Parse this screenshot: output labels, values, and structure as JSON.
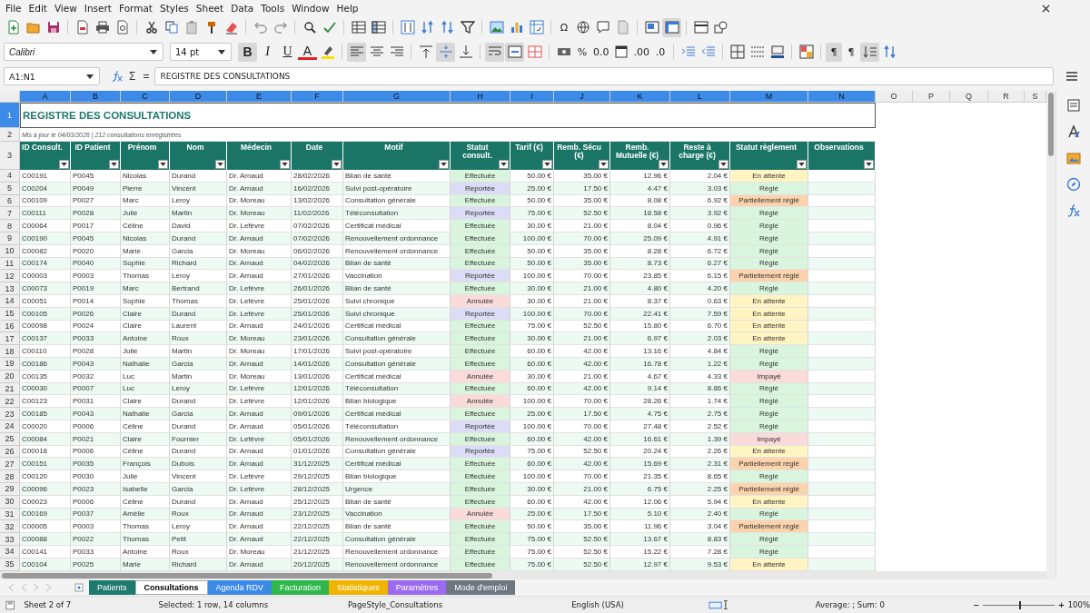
{
  "menu": [
    "File",
    "Edit",
    "View",
    "Insert",
    "Format",
    "Styles",
    "Sheet",
    "Data",
    "Tools",
    "Window",
    "Help"
  ],
  "toolbar_1": [
    {
      "kind": "new",
      "pressed": false
    },
    {
      "kind": "open",
      "pressed": false
    },
    {
      "kind": "save",
      "pressed": false
    },
    {
      "kind": "pdf",
      "pressed": false
    },
    {
      "kind": "print",
      "pressed": false
    },
    {
      "kind": "preview",
      "pressed": false
    },
    {
      "kind": "cut",
      "pressed": false
    },
    {
      "kind": "copy",
      "pressed": false
    },
    {
      "kind": "paste",
      "pressed": false
    },
    {
      "kind": "clone",
      "pressed": false
    },
    {
      "kind": "clear",
      "pressed": false
    },
    {
      "kind": "undo",
      "pressed": false
    },
    {
      "kind": "redo",
      "pressed": false
    },
    {
      "kind": "find",
      "pressed": false
    },
    {
      "kind": "spell",
      "pressed": false
    },
    {
      "kind": "rows",
      "pressed": false
    },
    {
      "kind": "cols",
      "pressed": false
    },
    {
      "kind": "sort",
      "pressed": false
    },
    {
      "kind": "sortasc",
      "pressed": false
    },
    {
      "kind": "sortdesc",
      "pressed": false
    },
    {
      "kind": "filter",
      "pressed": false
    },
    {
      "kind": "image",
      "pressed": false
    },
    {
      "kind": "chart",
      "pressed": false
    },
    {
      "kind": "pivot",
      "pressed": false
    },
    {
      "kind": "char",
      "label": "Ω",
      "pressed": false
    },
    {
      "kind": "link",
      "pressed": false
    },
    {
      "kind": "comment",
      "pressed": false
    },
    {
      "kind": "headerfooter",
      "pressed": false
    },
    {
      "kind": "printarea",
      "pressed": false
    },
    {
      "kind": "freeze",
      "pressed": true
    },
    {
      "kind": "split",
      "pressed": false
    },
    {
      "kind": "shapes",
      "pressed": false
    }
  ],
  "font_name": "Calibri",
  "font_size": "14 pt",
  "toolbar_2": [
    {
      "kind": "bold",
      "label": "B",
      "pressed": true
    },
    {
      "kind": "italic",
      "label": "I",
      "pressed": false
    },
    {
      "kind": "underline",
      "label": "U",
      "pressed": false
    },
    {
      "kind": "fontcolor",
      "label": "A",
      "pressed": false
    },
    {
      "kind": "highlight",
      "pressed": false
    },
    {
      "kind": "alignleft",
      "pressed": true
    },
    {
      "kind": "aligncenter",
      "pressed": false
    },
    {
      "kind": "alignright",
      "pressed": false
    },
    {
      "kind": "aligntop",
      "pressed": false
    },
    {
      "kind": "alignmiddle",
      "pressed": true
    },
    {
      "kind": "alignbottom",
      "pressed": false
    },
    {
      "kind": "wrap",
      "pressed": true
    },
    {
      "kind": "merge",
      "pressed": true
    },
    {
      "kind": "unmerge",
      "pressed": false
    },
    {
      "kind": "currency",
      "pressed": false
    },
    {
      "kind": "char",
      "label": "%",
      "pressed": false
    },
    {
      "kind": "char",
      "label": "0.0",
      "pressed": false
    },
    {
      "kind": "date",
      "pressed": false
    },
    {
      "kind": "char",
      "label": ".00",
      "pressed": false
    },
    {
      "kind": "char",
      "label": ".0",
      "pressed": false
    },
    {
      "kind": "indent",
      "pressed": false
    },
    {
      "kind": "outdent",
      "pressed": false
    },
    {
      "kind": "borders",
      "pressed": false
    },
    {
      "kind": "borderstyle",
      "pressed": false
    },
    {
      "kind": "bordercolor",
      "pressed": false
    },
    {
      "kind": "conditional",
      "pressed": false
    },
    {
      "kind": "char",
      "label": "¶",
      "pressed": true
    },
    {
      "kind": "char",
      "label": "¶",
      "pressed": false
    },
    {
      "kind": "textdir",
      "pressed": true
    },
    {
      "kind": "sortdesc",
      "pressed": false
    }
  ],
  "formula_bar": {
    "name_box": "A1:N1",
    "sum": "Σ",
    "equals": "=",
    "content": "REGISTRE DES CONSULTATIONS"
  },
  "columns": [
    {
      "letter": "A",
      "selected": true
    },
    {
      "letter": "B",
      "selected": true
    },
    {
      "letter": "C",
      "selected": true
    },
    {
      "letter": "D",
      "selected": true
    },
    {
      "letter": "E",
      "selected": true
    },
    {
      "letter": "F",
      "selected": true
    },
    {
      "letter": "G",
      "selected": true
    },
    {
      "letter": "H",
      "selected": true
    },
    {
      "letter": "I",
      "selected": true
    },
    {
      "letter": "J",
      "selected": true
    },
    {
      "letter": "K",
      "selected": true
    },
    {
      "letter": "L",
      "selected": true
    },
    {
      "letter": "M",
      "selected": true
    },
    {
      "letter": "N",
      "selected": true
    },
    {
      "letter": "O",
      "selected": false
    },
    {
      "letter": "P",
      "selected": false
    },
    {
      "letter": "Q",
      "selected": false
    },
    {
      "letter": "R",
      "selected": false
    },
    {
      "letter": "S",
      "selected": false
    }
  ],
  "title_row": {
    "n": "1",
    "text": "REGISTRE DES CONSULTATIONS",
    "selected": true
  },
  "subtitle_row": {
    "n": "2",
    "text": "Mis à jour le 04/03/2026 | 212 consultations enregistrées"
  },
  "header_row": {
    "n": "3",
    "headers": [
      "ID Consult.",
      "ID Patient",
      "Prénom",
      "Nom",
      "Médecin",
      "Date",
      "Motif",
      "Statut consult.",
      "Tarif (€)",
      "Remb. Sécu (€)",
      "Remb. Mutuelle (€)",
      "Reste à charge (€)",
      "Statut règlement",
      "Observations"
    ]
  },
  "rows": [
    {
      "n": "4",
      "cells": [
        "C00191",
        "P0045",
        "Nicolas",
        "Durand",
        "Dr. Arnaud",
        "28/02/2026",
        "Bilan de santé"
      ],
      "statut": {
        "text": "Effectuée",
        "color": "#d9f5dd"
      },
      "amounts": [
        "50.00 €",
        "35.00 €",
        "12.96 €",
        "2.04 €"
      ],
      "reglement": {
        "text": "En attente",
        "color": "#fff4c2"
      }
    },
    {
      "n": "5",
      "cells": [
        "C00204",
        "P0049",
        "Pierre",
        "Vincent",
        "Dr. Arnaud",
        "16/02/2026",
        "Suivi post-opératoire"
      ],
      "statut": {
        "text": "Reportée",
        "color": "#dcdcf7"
      },
      "amounts": [
        "25.00 €",
        "17.50 €",
        "4.47 €",
        "3.03 €"
      ],
      "reglement": {
        "text": "Réglé",
        "color": "#d9f5dd"
      }
    },
    {
      "n": "6",
      "cells": [
        "C00109",
        "P0027",
        "Marc",
        "Leroy",
        "Dr. Moreau",
        "13/02/2026",
        "Consultation générale"
      ],
      "statut": {
        "text": "Effectuée",
        "color": "#d9f5dd"
      },
      "amounts": [
        "50.00 €",
        "35.00 €",
        "8.08 €",
        "6.92 €"
      ],
      "reglement": {
        "text": "Partiellement réglé",
        "color": "#fcd3ac"
      }
    },
    {
      "n": "7",
      "cells": [
        "C00111",
        "P0028",
        "Julie",
        "Martin",
        "Dr. Moreau",
        "11/02/2026",
        "Téléconsultation"
      ],
      "statut": {
        "text": "Reportée",
        "color": "#dcdcf7"
      },
      "amounts": [
        "75.00 €",
        "52.50 €",
        "18.58 €",
        "3.92 €"
      ],
      "reglement": {
        "text": "Réglé",
        "color": "#d9f5dd"
      }
    },
    {
      "n": "8",
      "cells": [
        "C00064",
        "P0017",
        "Céline",
        "David",
        "Dr. Lefèvre",
        "07/02/2026",
        "Certificat médical"
      ],
      "statut": {
        "text": "Effectuée",
        "color": "#d9f5dd"
      },
      "amounts": [
        "30.00 €",
        "21.00 €",
        "8.04 €",
        "0.96 €"
      ],
      "reglement": {
        "text": "Réglé",
        "color": "#d9f5dd"
      }
    },
    {
      "n": "9",
      "cells": [
        "C00190",
        "P0045",
        "Nicolas",
        "Durand",
        "Dr. Arnaud",
        "07/02/2026",
        "Renouvellement ordonnance"
      ],
      "statut": {
        "text": "Effectuée",
        "color": "#d9f5dd"
      },
      "amounts": [
        "100.00 €",
        "70.00 €",
        "25.09 €",
        "4.91 €"
      ],
      "reglement": {
        "text": "Réglé",
        "color": "#d9f5dd"
      }
    },
    {
      "n": "10",
      "cells": [
        "C00082",
        "P0020",
        "Marie",
        "Garcia",
        "Dr. Moreau",
        "06/02/2026",
        "Renouvellement ordonnance"
      ],
      "statut": {
        "text": "Effectuée",
        "color": "#d9f5dd"
      },
      "amounts": [
        "50.00 €",
        "35.00 €",
        "8.28 €",
        "6.72 €"
      ],
      "reglement": {
        "text": "Réglé",
        "color": "#d9f5dd"
      }
    },
    {
      "n": "11",
      "cells": [
        "C00174",
        "P0040",
        "Sophie",
        "Richard",
        "Dr. Arnaud",
        "04/02/2026",
        "Bilan de santé"
      ],
      "statut": {
        "text": "Effectuée",
        "color": "#d9f5dd"
      },
      "amounts": [
        "50.00 €",
        "35.00 €",
        "8.73 €",
        "6.27 €"
      ],
      "reglement": {
        "text": "Réglé",
        "color": "#d9f5dd"
      }
    },
    {
      "n": "12",
      "cells": [
        "C00003",
        "P0003",
        "Thomas",
        "Leroy",
        "Dr. Arnaud",
        "27/01/2026",
        "Vaccination"
      ],
      "statut": {
        "text": "Reportée",
        "color": "#dcdcf7"
      },
      "amounts": [
        "100.00 €",
        "70.00 €",
        "23.85 €",
        "6.15 €"
      ],
      "reglement": {
        "text": "Partiellement réglé",
        "color": "#fcd3ac"
      }
    },
    {
      "n": "13",
      "cells": [
        "C00073",
        "P0019",
        "Marc",
        "Bertrand",
        "Dr. Lefèvre",
        "26/01/2026",
        "Bilan de santé"
      ],
      "statut": {
        "text": "Effectuée",
        "color": "#d9f5dd"
      },
      "amounts": [
        "30.00 €",
        "21.00 €",
        "4.80 €",
        "4.20 €"
      ],
      "reglement": {
        "text": "Réglé",
        "color": "#d9f5dd"
      }
    },
    {
      "n": "14",
      "cells": [
        "C00051",
        "P0014",
        "Sophie",
        "Thomas",
        "Dr. Lefèvre",
        "25/01/2026",
        "Suivi chronique"
      ],
      "statut": {
        "text": "Annulée",
        "color": "#fbdada"
      },
      "amounts": [
        "30.00 €",
        "21.00 €",
        "8.37 €",
        "0.63 €"
      ],
      "reglement": {
        "text": "En attente",
        "color": "#fff4c2"
      }
    },
    {
      "n": "15",
      "cells": [
        "C00105",
        "P0026",
        "Claire",
        "Durand",
        "Dr. Lefèvre",
        "25/01/2026",
        "Suivi chronique"
      ],
      "statut": {
        "text": "Reportée",
        "color": "#dcdcf7"
      },
      "amounts": [
        "100.00 €",
        "70.00 €",
        "22.41 €",
        "7.59 €"
      ],
      "reglement": {
        "text": "En attente",
        "color": "#fff4c2"
      }
    },
    {
      "n": "16",
      "cells": [
        "C00098",
        "P0024",
        "Claire",
        "Laurent",
        "Dr. Arnaud",
        "24/01/2026",
        "Certificat médical"
      ],
      "statut": {
        "text": "Effectuée",
        "color": "#d9f5dd"
      },
      "amounts": [
        "75.00 €",
        "52.50 €",
        "15.80 €",
        "6.70 €"
      ],
      "reglement": {
        "text": "En attente",
        "color": "#fff4c2"
      }
    },
    {
      "n": "17",
      "cells": [
        "C00137",
        "P0033",
        "Antoine",
        "Roux",
        "Dr. Moreau",
        "23/01/2026",
        "Consultation générale"
      ],
      "statut": {
        "text": "Effectuée",
        "color": "#d9f5dd"
      },
      "amounts": [
        "30.00 €",
        "21.00 €",
        "6.97 €",
        "2.03 €"
      ],
      "reglement": {
        "text": "En attente",
        "color": "#fff4c2"
      }
    },
    {
      "n": "18",
      "cells": [
        "C00110",
        "P0028",
        "Julie",
        "Martin",
        "Dr. Moreau",
        "17/01/2026",
        "Suivi post-opératoire"
      ],
      "statut": {
        "text": "Effectuée",
        "color": "#d9f5dd"
      },
      "amounts": [
        "60.00 €",
        "42.00 €",
        "13.16 €",
        "4.84 €"
      ],
      "reglement": {
        "text": "Réglé",
        "color": "#d9f5dd"
      }
    },
    {
      "n": "19",
      "cells": [
        "C00186",
        "P0043",
        "Nathalie",
        "Garcia",
        "Dr. Arnaud",
        "14/01/2026",
        "Consultation générale"
      ],
      "statut": {
        "text": "Effectuée",
        "color": "#d9f5dd"
      },
      "amounts": [
        "60.00 €",
        "42.00 €",
        "16.78 €",
        "1.22 €"
      ],
      "reglement": {
        "text": "Réglé",
        "color": "#d9f5dd"
      }
    },
    {
      "n": "20",
      "cells": [
        "C00135",
        "P0032",
        "Luc",
        "Martin",
        "Dr. Moreau",
        "13/01/2026",
        "Certificat médical"
      ],
      "statut": {
        "text": "Annulée",
        "color": "#fbdada"
      },
      "amounts": [
        "30.00 €",
        "21.00 €",
        "4.67 €",
        "4.33 €"
      ],
      "reglement": {
        "text": "Impayé",
        "color": "#fbdada"
      }
    },
    {
      "n": "21",
      "cells": [
        "C00030",
        "P0007",
        "Luc",
        "Leroy",
        "Dr. Lefèvre",
        "12/01/2026",
        "Téléconsultation"
      ],
      "statut": {
        "text": "Effectuée",
        "color": "#d9f5dd"
      },
      "amounts": [
        "60.00 €",
        "42.00 €",
        "9.14 €",
        "8.86 €"
      ],
      "reglement": {
        "text": "Réglé",
        "color": "#d9f5dd"
      }
    },
    {
      "n": "22",
      "cells": [
        "C00123",
        "P0031",
        "Claire",
        "Durand",
        "Dr. Lefèvre",
        "12/01/2026",
        "Bilan biologique"
      ],
      "statut": {
        "text": "Annulée",
        "color": "#fbdada"
      },
      "amounts": [
        "100.00 €",
        "70.00 €",
        "28.26 €",
        "1.74 €"
      ],
      "reglement": {
        "text": "Réglé",
        "color": "#d9f5dd"
      }
    },
    {
      "n": "23",
      "cells": [
        "C00185",
        "P0043",
        "Nathalie",
        "Garcia",
        "Dr. Arnaud",
        "09/01/2026",
        "Certificat médical"
      ],
      "statut": {
        "text": "Effectuée",
        "color": "#d9f5dd"
      },
      "amounts": [
        "25.00 €",
        "17.50 €",
        "4.75 €",
        "2.75 €"
      ],
      "reglement": {
        "text": "Réglé",
        "color": "#d9f5dd"
      }
    },
    {
      "n": "24",
      "cells": [
        "C00020",
        "P0006",
        "Céline",
        "Durand",
        "Dr. Arnaud",
        "05/01/2026",
        "Téléconsultation"
      ],
      "statut": {
        "text": "Reportée",
        "color": "#dcdcf7"
      },
      "amounts": [
        "100.00 €",
        "70.00 €",
        "27.48 €",
        "2.52 €"
      ],
      "reglement": {
        "text": "Réglé",
        "color": "#d9f5dd"
      }
    },
    {
      "n": "25",
      "cells": [
        "C00084",
        "P0021",
        "Claire",
        "Fournier",
        "Dr. Lefèvre",
        "05/01/2026",
        "Renouvellement ordonnance"
      ],
      "statut": {
        "text": "Effectuée",
        "color": "#d9f5dd"
      },
      "amounts": [
        "60.00 €",
        "42.00 €",
        "16.61 €",
        "1.39 €"
      ],
      "reglement": {
        "text": "Impayé",
        "color": "#fbdada"
      }
    },
    {
      "n": "26",
      "cells": [
        "C00018",
        "P0006",
        "Céline",
        "Durand",
        "Dr. Arnaud",
        "01/01/2026",
        "Consultation générale"
      ],
      "statut": {
        "text": "Reportée",
        "color": "#dcdcf7"
      },
      "amounts": [
        "75.00 €",
        "52.50 €",
        "20.24 €",
        "2.26 €"
      ],
      "reglement": {
        "text": "En attente",
        "color": "#fff4c2"
      }
    },
    {
      "n": "27",
      "cells": [
        "C00151",
        "P0035",
        "François",
        "Dubois",
        "Dr. Arnaud",
        "31/12/2025",
        "Certificat médical"
      ],
      "statut": {
        "text": "Effectuée",
        "color": "#d9f5dd"
      },
      "amounts": [
        "60.00 €",
        "42.00 €",
        "15.69 €",
        "2.31 €"
      ],
      "reglement": {
        "text": "Partiellement réglé",
        "color": "#fcd3ac"
      }
    },
    {
      "n": "28",
      "cells": [
        "C00120",
        "P0030",
        "Julie",
        "Vincent",
        "Dr. Lefèvre",
        "29/12/2025",
        "Bilan biologique"
      ],
      "statut": {
        "text": "Effectuée",
        "color": "#d9f5dd"
      },
      "amounts": [
        "100.00 €",
        "70.00 €",
        "21.35 €",
        "8.65 €"
      ],
      "reglement": {
        "text": "Réglé",
        "color": "#d9f5dd"
      }
    },
    {
      "n": "29",
      "cells": [
        "C00096",
        "P0023",
        "Isabelle",
        "Garcia",
        "Dr. Lefèvre",
        "28/12/2025",
        "Urgence"
      ],
      "statut": {
        "text": "Effectuée",
        "color": "#d9f5dd"
      },
      "amounts": [
        "30.00 €",
        "21.00 €",
        "6.75 €",
        "2.25 €"
      ],
      "reglement": {
        "text": "Partiellement réglé",
        "color": "#fcd3ac"
      }
    },
    {
      "n": "30",
      "cells": [
        "C00023",
        "P0006",
        "Céline",
        "Durand",
        "Dr. Arnaud",
        "25/12/2025",
        "Bilan de santé"
      ],
      "statut": {
        "text": "Effectuée",
        "color": "#d9f5dd"
      },
      "amounts": [
        "60.00 €",
        "42.00 €",
        "12.06 €",
        "5.94 €"
      ],
      "reglement": {
        "text": "En attente",
        "color": "#fff4c2"
      }
    },
    {
      "n": "31",
      "cells": [
        "C00169",
        "P0037",
        "Amélie",
        "Roux",
        "Dr. Arnaud",
        "23/12/2025",
        "Vaccination"
      ],
      "statut": {
        "text": "Annulée",
        "color": "#fbdada"
      },
      "amounts": [
        "25.00 €",
        "17.50 €",
        "5.10 €",
        "2.40 €"
      ],
      "reglement": {
        "text": "Réglé",
        "color": "#d9f5dd"
      }
    },
    {
      "n": "32",
      "cells": [
        "C00005",
        "P0003",
        "Thomas",
        "Leroy",
        "Dr. Arnaud",
        "22/12/2025",
        "Bilan de santé"
      ],
      "statut": {
        "text": "Effectuée",
        "color": "#d9f5dd"
      },
      "amounts": [
        "50.00 €",
        "35.00 €",
        "11.96 €",
        "3.04 €"
      ],
      "reglement": {
        "text": "Partiellement réglé",
        "color": "#fcd3ac"
      }
    },
    {
      "n": "33",
      "cells": [
        "C00088",
        "P0022",
        "Thomas",
        "Petit",
        "Dr. Arnaud",
        "22/12/2025",
        "Consultation générale"
      ],
      "statut": {
        "text": "Effectuée",
        "color": "#d9f5dd"
      },
      "amounts": [
        "75.00 €",
        "52.50 €",
        "13.67 €",
        "8.83 €"
      ],
      "reglement": {
        "text": "Réglé",
        "color": "#d9f5dd"
      }
    },
    {
      "n": "34",
      "cells": [
        "C00141",
        "P0033",
        "Antoine",
        "Roux",
        "Dr. Moreau",
        "21/12/2025",
        "Renouvellement ordonnance"
      ],
      "statut": {
        "text": "Effectuée",
        "color": "#d9f5dd"
      },
      "amounts": [
        "75.00 €",
        "52.50 €",
        "15.22 €",
        "7.28 €"
      ],
      "reglement": {
        "text": "Réglé",
        "color": "#d9f5dd"
      }
    },
    {
      "n": "35",
      "cells": [
        "C00104",
        "P0025",
        "Marie",
        "Richard",
        "Dr. Arnaud",
        "20/12/2025",
        "Renouvellement ordonnance"
      ],
      "statut": {
        "text": "Effectuée",
        "color": "#d9f5dd"
      },
      "amounts": [
        "75.00 €",
        "52.50 €",
        "12.97 €",
        "9.53 €"
      ],
      "reglement": {
        "text": "En attente",
        "color": "#fff4c2"
      }
    }
  ],
  "sheet_tabs": [
    {
      "label": "Patients",
      "color": "#1f7a6e",
      "selected": false
    },
    {
      "label": "Consultations",
      "selected": true
    },
    {
      "label": "Agenda RDV",
      "color": "#3c8ae8",
      "selected": false
    },
    {
      "label": "Facturation",
      "color": "#2eb84c",
      "selected": false
    },
    {
      "label": "Statistiques",
      "color": "#f0b400",
      "selected": false
    },
    {
      "label": "Paramètres",
      "color": "#9a6af0",
      "selected": false
    },
    {
      "label": "Mode d'emploi",
      "color": "#6f7680",
      "selected": false
    }
  ],
  "status_bar": {
    "sheet": "Sheet 2 of 7",
    "selection": "Selected: 1 row, 14 columns",
    "page_style": "PageStyle_Consultations",
    "language": "English (USA)",
    "summary": "Average: ; Sum: 0",
    "zoom_minus": "−",
    "zoom_plus": "+",
    "zoom": "100%",
    "level": 0.5
  }
}
